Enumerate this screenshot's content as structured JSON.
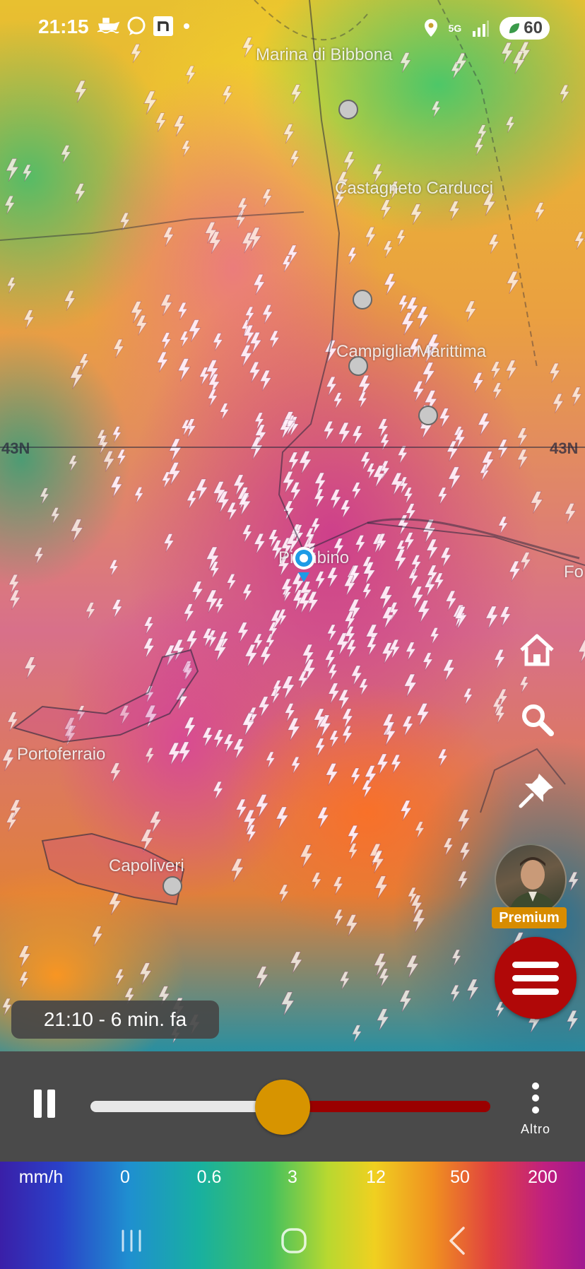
{
  "status_bar": {
    "time": "21:15",
    "notification_icons": [
      "boat-icon",
      "whatsapp-icon",
      "n-app-icon",
      "dot-icon"
    ],
    "network": "5G",
    "battery": "60"
  },
  "map": {
    "places": [
      "Marina di Bibbona",
      "Castagneto Carducci",
      "Campiglia Marittima",
      "Piombino",
      "Portoferraio",
      "Capoliveri",
      "Fo"
    ],
    "latitude_labels": [
      "43N",
      "43N"
    ],
    "layer": "lightning + precipitation radar",
    "accent_colors": {
      "lightning": "#ffffff",
      "location_pin": "#1e9be6"
    }
  },
  "map_controls": {
    "home": "home-icon",
    "search": "search-icon",
    "pin": "pushpin-icon",
    "premium_label": "Premium",
    "menu": "hamburger-menu-icon"
  },
  "timestamp_chip": "21:10 - 6 min. fa",
  "player": {
    "state": "playing",
    "progress": 0.48,
    "more_label": "Altro",
    "colors": {
      "played": "#e8e8e8",
      "remaining": "#9a0000",
      "thumb": "#d79400"
    }
  },
  "legend": {
    "unit": "mm/h",
    "values": [
      "0",
      "0.6",
      "3",
      "12",
      "50",
      "200"
    ]
  },
  "nav_bar": [
    "recents-icon",
    "home-circle-icon",
    "back-icon"
  ]
}
